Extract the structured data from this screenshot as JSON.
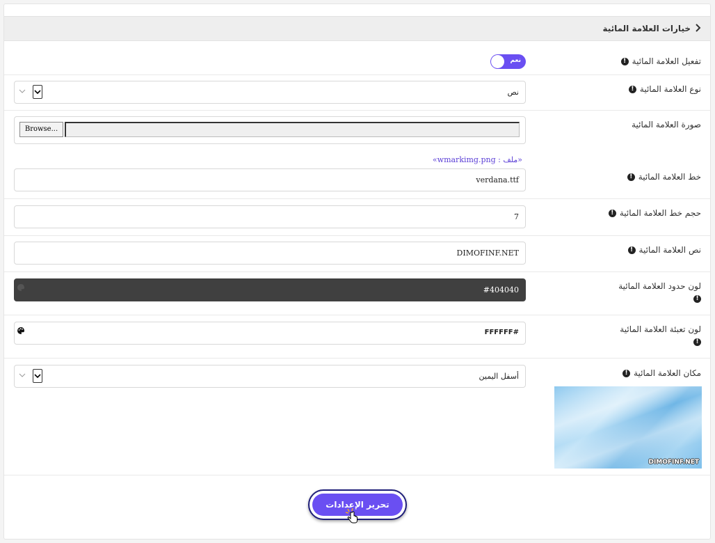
{
  "section": {
    "title": "خيارات العلامة المائية"
  },
  "fields": {
    "enable": {
      "label": "تفعيل العلامة المائية",
      "toggle_text": "نعم",
      "on": true
    },
    "type": {
      "label": "نوع العلامة المائية",
      "value": "نص"
    },
    "image": {
      "label": "صورة العلامة المائية",
      "browse_label": "Browse...",
      "current_file": "«ملف : wmarkimg.png»"
    },
    "font": {
      "label": "خط العلامة المائية",
      "value": "verdana.ttf"
    },
    "size": {
      "label": "حجم خط العلامة المائية",
      "value": "7"
    },
    "text": {
      "label": "نص العلامة المائية",
      "value": "DIMOFINF.NET"
    },
    "border_color": {
      "label": "لون حدود العلامة المائية",
      "value": "#404040"
    },
    "fill_color": {
      "label": "لون تعبئة العلامة المائية",
      "value": "FFFFFF#"
    },
    "position": {
      "label": "مكان العلامة المائية",
      "value": "أسفل اليمين",
      "preview_text": "DIMOFINF.NET"
    }
  },
  "info_glyph": "!",
  "submit": {
    "label": "تحرير الإعدادات"
  },
  "icons": [
    "chevron-right-icon",
    "info-icon",
    "chevron-down-icon",
    "palette-icon",
    "hand-pointer-icon"
  ],
  "colors": {
    "accent": "#6a4ff2",
    "dark_field": "#404040",
    "header_bg": "#eeeeee",
    "link": "#5b3fd6"
  }
}
